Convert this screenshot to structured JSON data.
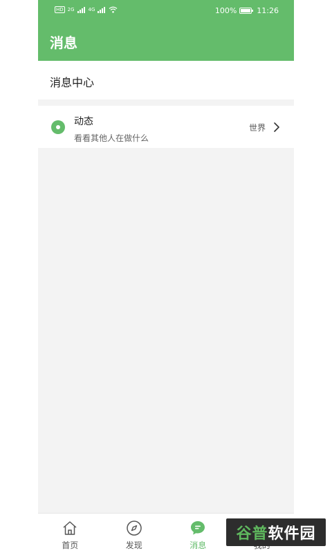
{
  "status_bar": {
    "network_left": "HD",
    "signal_1": "2G",
    "signal_2": "4G",
    "battery_percent": "100%",
    "time": "11:26"
  },
  "app_bar": {
    "title": "消息"
  },
  "section": {
    "title": "消息中心"
  },
  "list": {
    "items": [
      {
        "title": "动态",
        "subtitle": "看看其他人在做什么",
        "right_text": "世界",
        "icon": "radio-dot-icon"
      }
    ]
  },
  "bottom_nav": {
    "items": [
      {
        "label": "首页",
        "icon": "home-icon"
      },
      {
        "label": "发现",
        "icon": "compass-icon"
      },
      {
        "label": "消息",
        "icon": "message-icon"
      },
      {
        "label": "我的",
        "icon": "user-icon"
      }
    ],
    "active_index": 2
  },
  "watermark": {
    "part1": "谷普",
    "part2": "软件园"
  },
  "colors": {
    "brand": "#64bc6b",
    "background": "#f3f3f3",
    "text_primary": "#222222",
    "text_secondary": "#666666"
  }
}
